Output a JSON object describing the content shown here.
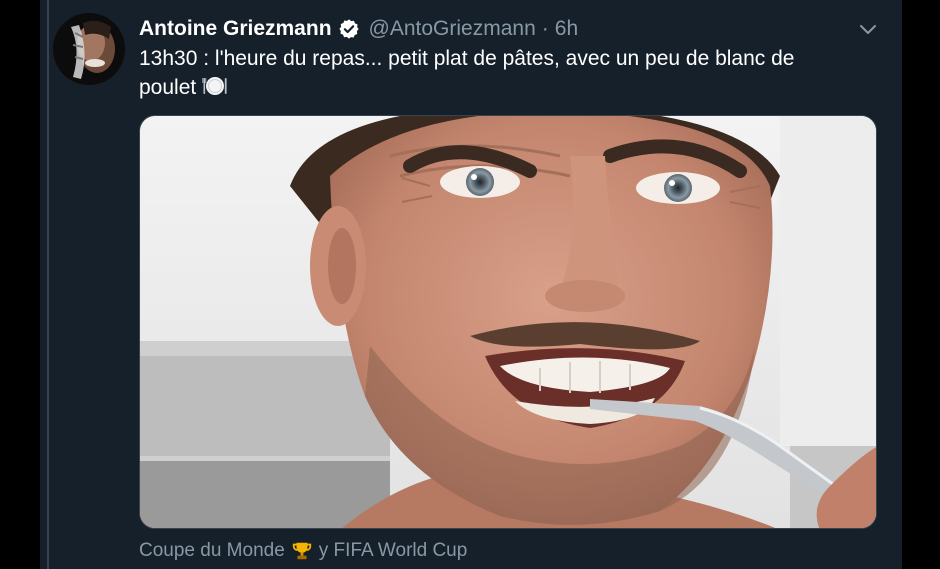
{
  "tweet": {
    "display_name": "Antoine Griezmann",
    "handle": "@AntoGriezmann",
    "separator": "·",
    "time": "6h",
    "text_line1": "13h30 : l'heure du repas... petit plat de pâtes, avec un peu de blanc de",
    "text_line2": "poulet",
    "verified": true
  },
  "icons": {
    "verified": "verified-badge-icon",
    "caret": "chevron-down-icon",
    "plate": "fork-knife-plate-emoji",
    "trophy": "trophy-emoji"
  },
  "footer": {
    "label_before": "Coupe du Monde",
    "label_after": "y FIFA World Cup"
  },
  "colors": {
    "background": "#15202b",
    "text_primary": "#ffffff",
    "text_secondary": "#8899a6",
    "border": "#38444d",
    "accent": "#1da1f2"
  }
}
